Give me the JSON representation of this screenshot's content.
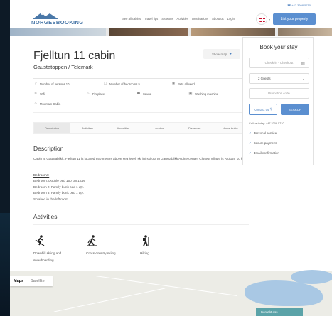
{
  "topbar": {
    "phone": "☎ +47 3208 5710",
    "logo_text": "NORGESBOOKING",
    "nav": [
      "See all cabins",
      "Travel tips",
      "Seasons",
      "Activities",
      "Destinations",
      "About us",
      "Login"
    ],
    "list_button": "List your property"
  },
  "listing": {
    "title": "Fjelltun 11 cabin",
    "subtitle": "Gaustatoppen / Telemark",
    "show_map": "Show map"
  },
  "features": [
    {
      "icon": "person-icon",
      "glyph": "♂",
      "label": "Number of persons 10"
    },
    {
      "icon": "bed-icon",
      "glyph": "□",
      "label": "Number of bedrooms 5"
    },
    {
      "icon": "paw-icon",
      "glyph": "❀",
      "label": "Pets allowed"
    },
    {
      "icon": "wifi-icon",
      "glyph": "≈",
      "label": "Wifi"
    },
    {
      "icon": "fireplace-icon",
      "glyph": "♨",
      "label": "Fireplace"
    },
    {
      "icon": "sauna-icon",
      "glyph": "☗",
      "label": "Sauna"
    },
    {
      "icon": "washing-machine-icon",
      "glyph": "▣",
      "label": "Washing machine"
    },
    {
      "icon": "mountain-cabin-icon",
      "glyph": "⌂",
      "label": "Mountain Cabin"
    }
  ],
  "tabs": [
    "Description",
    "Activities",
    "Amenities",
    "Location",
    "Distances",
    "Home truths"
  ],
  "description": {
    "heading": "Description",
    "text": "Cabin at Gaustablikk. Fjelltun 11 is located 950 meters above sea level, ski in/ ski out to Gaustablikk Alpine center. Closest village is Rjukan, 10 km.",
    "bedrooms_title": "Bedrooms:",
    "bedrooms": [
      "Bedroom: Double bed 150 cm 1 qty.",
      "Bedroom 2: Family bunk bed 1 qty.",
      "Bedroom 3: Family bunk bed 1 qty.",
      "Sofabed in the loft room"
    ]
  },
  "activities": {
    "heading": "Activities",
    "items": [
      {
        "icon": "downhill-skiing-icon",
        "glyph": "⛷",
        "label": "Downhill skiing and snowboarding"
      },
      {
        "icon": "cross-country-skiing-icon",
        "glyph": "⛷",
        "label": "Cross-country skiing"
      },
      {
        "icon": "hiking-icon",
        "glyph": "⛹",
        "label": "Hiking"
      }
    ]
  },
  "booking": {
    "heading": "Book your stay",
    "dates_placeholder": "Check-in - Checkout",
    "guests": "2 Guests",
    "promo_placeholder": "Promotion code",
    "contact_button": "Contact us",
    "search_button": "SEARCH",
    "call_us": "Call us today: +47 3208 5710",
    "perks": [
      "Personal service",
      "Secure payment",
      "Email confirmation"
    ]
  },
  "map": {
    "tab_map": "Maps",
    "tab_satellite": "Satellite",
    "contact_label": "Kontakt oss"
  },
  "colors": {
    "accent": "#5b8fd0",
    "background": "#0d1a26"
  }
}
